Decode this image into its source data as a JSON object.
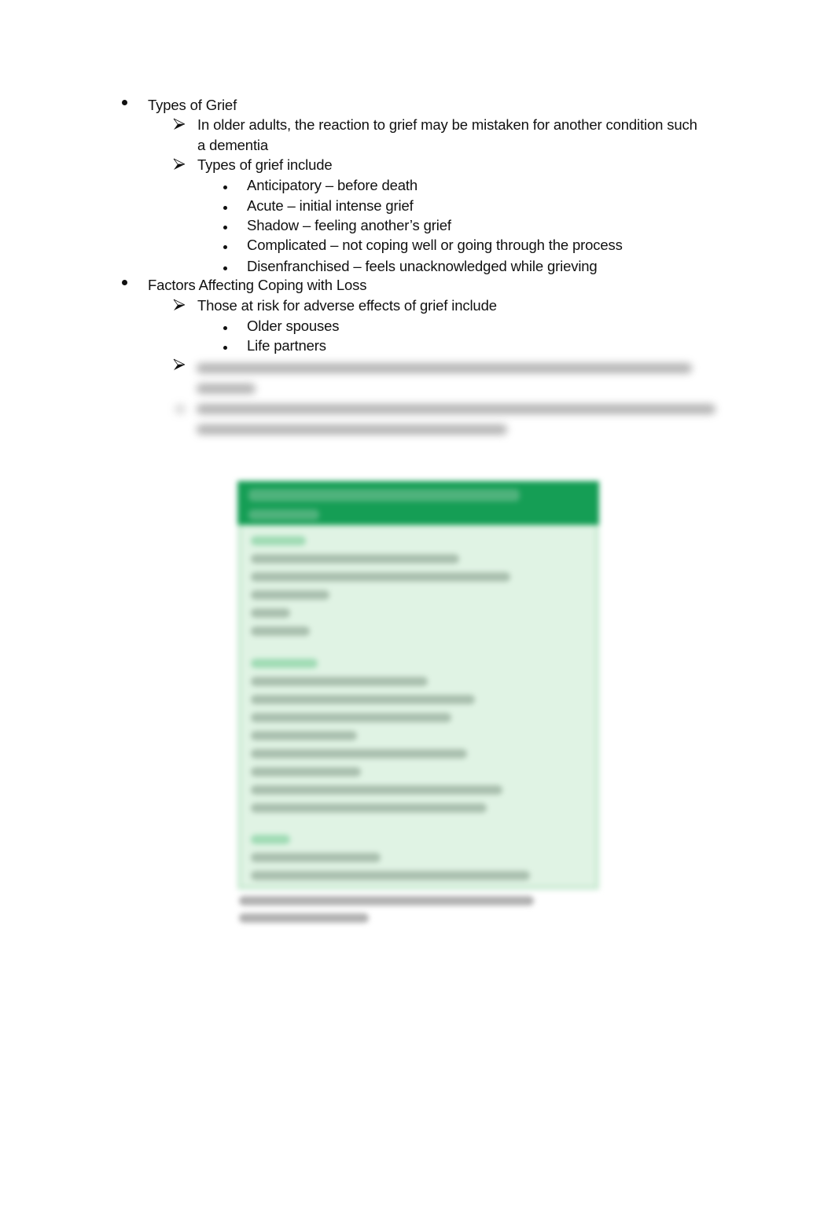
{
  "document": {
    "sections": [
      {
        "title": "Types of Grief",
        "items": [
          {
            "text": "In older adults, the reaction to grief may be mistaken for another condition such",
            "continuation": "a dementia"
          },
          {
            "text": "Types of grief include",
            "subitems": [
              "Anticipatory – before death",
              "Acute – initial intense grief",
              "Shadow – feeling another’s grief",
              "Complicated – not coping well or going through the process",
              "Disenfranchised – feels unacknowledged while grieving"
            ]
          }
        ]
      },
      {
        "title": "Factors Affecting Coping with Loss",
        "items": [
          {
            "text": "Those at risk for adverse effects of grief include",
            "subitems": [
              "Older spouses",
              "Life partners"
            ]
          }
        ]
      }
    ],
    "blurred_preview": {
      "note": "Remaining content is blurred (preview locked)",
      "box_color_header": "#159e55",
      "box_color_body": "#e0f3e4"
    }
  }
}
